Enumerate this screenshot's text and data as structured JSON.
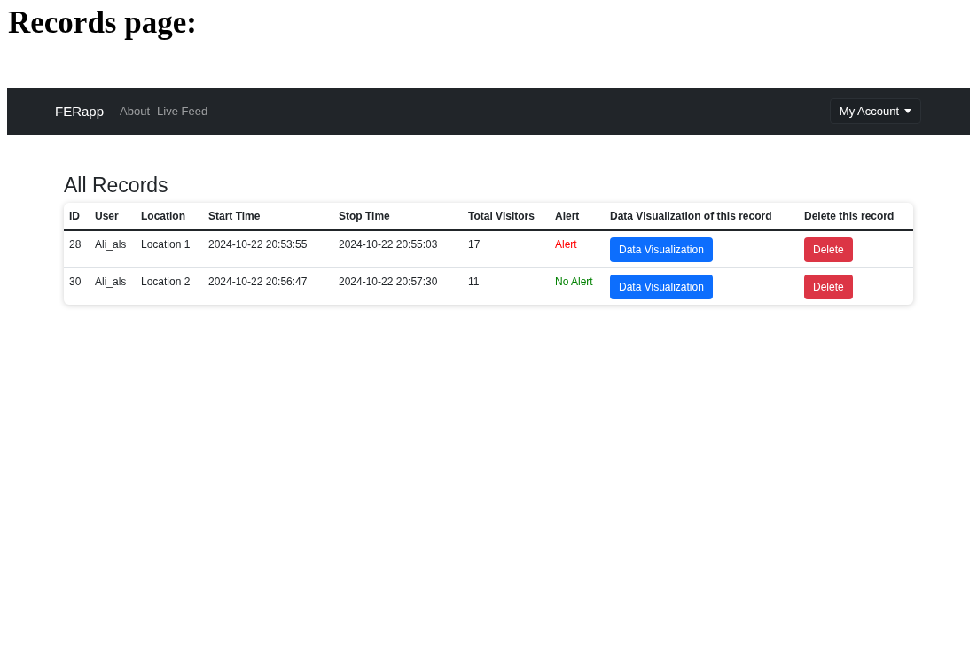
{
  "page_heading": "Records page:",
  "navbar": {
    "brand": "FERapp",
    "links": [
      "About",
      "Live Feed"
    ],
    "account_menu": "My Account"
  },
  "title": "All Records",
  "table": {
    "columns": [
      "ID",
      "User",
      "Location",
      "Start Time",
      "Stop Time",
      "Total Visitors",
      "Alert",
      "Data Visualization of this record",
      "Delete this record"
    ],
    "rows": [
      {
        "id": "28",
        "user": "Ali_als",
        "location": "Location 1",
        "start": "2024-10-22 20:53:55",
        "stop": "2024-10-22 20:55:03",
        "visitors": "17",
        "alert": {
          "text": "Alert",
          "active": true
        },
        "viz_button": "Data Visualization",
        "delete_button": "Delete"
      },
      {
        "id": "30",
        "user": "Ali_als",
        "location": "Location 2",
        "start": "2024-10-22 20:56:47",
        "stop": "2024-10-22 20:57:30",
        "visitors": "11",
        "alert": {
          "text": "No Alert",
          "active": false
        },
        "viz_button": "Data Visualization",
        "delete_button": "Delete"
      }
    ]
  }
}
